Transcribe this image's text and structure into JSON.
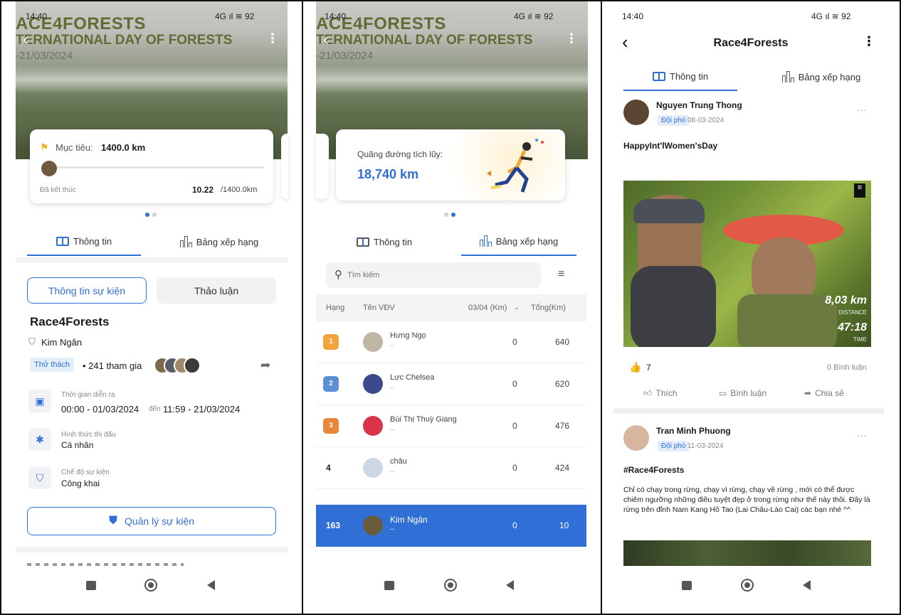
{
  "panel1": {
    "status_time": "14:40",
    "status_icons": "4G ⁠ıl ≋ 92",
    "hero": {
      "line1": "ACE4FORESTS",
      "line2": "TERNATIONAL DAY OF FORESTS",
      "line3": "-21/03/2024"
    },
    "goal_label": "Mục tiêu:",
    "goal_value": "1400.0 km",
    "progress_fraction": 0.007,
    "ended_label": "Đã kết thúc",
    "progress_value": "10.22",
    "progress_total": "/1400.0km",
    "tabs": [
      "Thông tin",
      "Bảng xếp hạng"
    ],
    "segment": [
      "Thông tin sự kiện",
      "Thảo luận"
    ],
    "event_title": "Race4Forests",
    "organizer": "Kim Ngân",
    "tag": "Thử thách",
    "participants": "• 241 tham gia",
    "time_label": "Thời gian diễn ra",
    "time_start": "00:00 - 01/03/2024",
    "time_mid": "đến",
    "time_end": "11:59 - 21/03/2024",
    "format_label": "Hình thức thi đấu",
    "format_value": "Cá nhân",
    "mode_label": "Chế độ sự kiện",
    "mode_value": "Công khai",
    "manage_button": "Quản lý sự kiện"
  },
  "panel2": {
    "status_time": "14:40",
    "status_icons": "4G ⁠ıl ≋ 92",
    "hero": {
      "line1": "ACE4FORESTS",
      "line2": "TERNATIONAL DAY OF FORESTS",
      "line3": "-21/03/2024"
    },
    "total_label": "Quãng đường tích lũy:",
    "total_value": "18,740 km",
    "tabs": [
      "Thông tin",
      "Bảng xếp hạng"
    ],
    "search_placeholder": "Tìm kiếm",
    "headers": [
      "Hạng",
      "Tên VĐV",
      "03/04 (Km)",
      "Tổng(Km)"
    ],
    "rows": [
      {
        "rank": "1",
        "name": "Hưng Ngọ",
        "sub": "--",
        "day": "0",
        "total": "640"
      },
      {
        "rank": "2",
        "name": "Lực Chelsea",
        "sub": "--",
        "day": "0",
        "total": "620"
      },
      {
        "rank": "3",
        "name": "Bùi Thị Thuỳ Giang",
        "sub": "--",
        "day": "0",
        "total": "476"
      },
      {
        "rank": "4",
        "name": "châu",
        "sub": "--",
        "day": "0",
        "total": "424"
      }
    ],
    "me": {
      "rank": "163",
      "name": "Kim Ngân",
      "sub": "--",
      "day": "0",
      "total": "10"
    }
  },
  "panel3": {
    "status_time": "14:40",
    "status_icons": "4G ⁠ıl ≋ 92",
    "title": "Race4Forests",
    "tabs": [
      "Thông tin",
      "Bảng xếp hạng"
    ],
    "post1": {
      "author": "Nguyen Trung Thong",
      "role": "Đội phó",
      "date": "08-03-2024",
      "text": "HappyInt'lWomen'sDay",
      "overlay_km": "8,03 km",
      "overlay_km_label": "DISTANCE",
      "overlay_time": "47:18",
      "overlay_time_label": "TIME",
      "likes": "7",
      "comments": "0 Bình luận"
    },
    "actions": [
      "Thích",
      "Bình luận",
      "Chia sẻ"
    ],
    "post2": {
      "author": "Tran Minh Phuong",
      "role": "Đội phó",
      "date": "11-03-2024",
      "hashtag": "#Race4Forests",
      "text": "Chỉ có chạy trong rừng, chạy vì rừng, chạy về rừng , mới có thể được chiêm ngưỡng những điều tuyệt đẹp ở trong rừng như thế này thôi. Đây là rừng trên đỉnh Nam Kang Hồ Tao (Lai Châu-Lào Cai) các bạn nhé ^^"
    }
  }
}
